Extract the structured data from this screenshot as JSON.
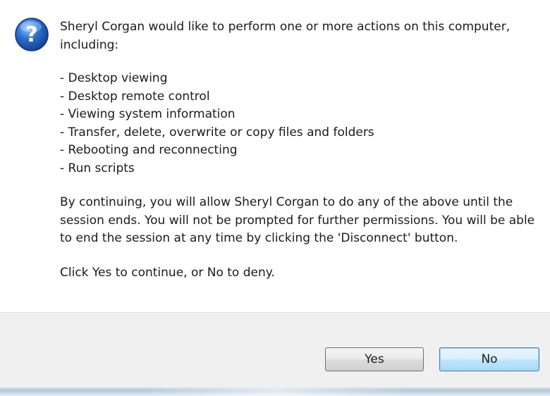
{
  "dialog": {
    "icon": "question-icon",
    "intro": "Sheryl Corgan would like to perform one or more actions on this computer, including:",
    "actions": [
      "- Desktop viewing",
      "- Desktop remote control",
      "- Viewing system information",
      "- Transfer, delete, overwrite or copy files and folders",
      "- Rebooting and reconnecting",
      "- Run scripts"
    ],
    "warning": "By continuing, you will allow Sheryl Corgan to do any of the above until the session ends. You will not be prompted for further permissions. You will be able to end the session at any time by clicking the 'Disconnect' button.",
    "prompt": "Click Yes to continue, or No to deny."
  },
  "buttons": {
    "yes_label": "Yes",
    "no_label": "No"
  },
  "colors": {
    "icon_blue": "#1f5fbf",
    "focus_border": "#3c7fb1",
    "footer_bg": "#f0f0f0"
  }
}
